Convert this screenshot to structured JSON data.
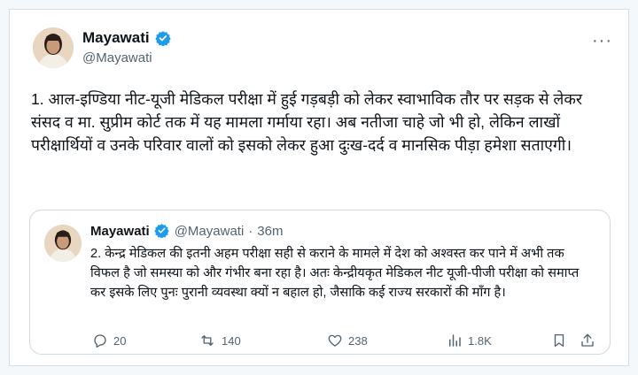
{
  "tweet": {
    "display_name": "Mayawati",
    "handle": "@Mayawati",
    "more_label": "···",
    "text": "1. आल-इण्डिया नीट-यूजी मेडिकल परीक्षा में हुई गड़बड़ी को लेकर स्वाभाविक तौर पर सड़क से लेकर संसद व मा. सुप्रीम कोर्ट तक में यह मामला गर्माया रहा। अब नतीजा चाहे जो भी हो, लेकिन लाखों परीक्षार्थियों व उनके परिवार वालों को इसको लेकर हुआ दुःख-दर्द व मानसिक पीड़ा हमेशा सताएगी।"
  },
  "quoted_tweet": {
    "display_name": "Mayawati",
    "handle": "@Mayawati",
    "separator": "·",
    "time": "36m",
    "text": "2. केन्द्र मेडिकल की इतनी अहम परीक्षा सही से कराने के मामले में देश को अश्वस्त कर पाने में अभी तक विफल है जो समस्या को और गंभीर बना रहा है। अतः केन्द्रीयकृत मेडिकल नीट यूजी-पीजी परीक्षा को समाप्त कर इसके लिए पुनः पुरानी व्यवस्था क्यों न बहाल हो, जैसाकि कई राज्य सरकारों की माँग है।",
    "actions": {
      "reply_count": "20",
      "retweet_count": "140",
      "like_count": "238",
      "views_count": "1.8K"
    }
  },
  "colors": {
    "verified": "#1d9bf0",
    "secondary_text": "#536471",
    "border": "#cfd9de"
  }
}
